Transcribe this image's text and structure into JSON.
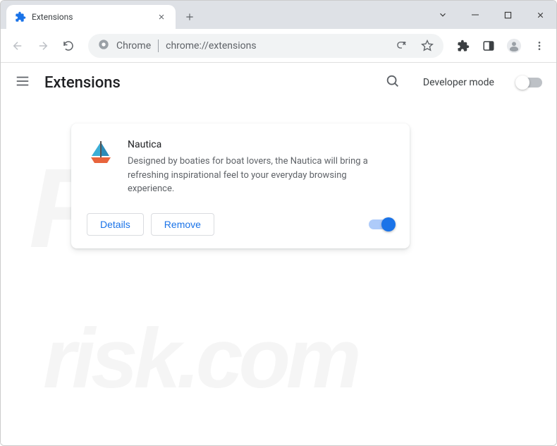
{
  "tab": {
    "title": "Extensions"
  },
  "address": {
    "chrome_label": "Chrome",
    "url": "chrome://extensions"
  },
  "header": {
    "title": "Extensions",
    "dev_mode_label": "Developer mode"
  },
  "extension": {
    "name": "Nautica",
    "description": "Designed by boaties for boat lovers, the Nautica will bring a refreshing inspirational feel to your everyday browsing experience.",
    "details_label": "Details",
    "remove_label": "Remove"
  },
  "watermark": {
    "line1": "PC",
    "line2": "risk.com"
  }
}
